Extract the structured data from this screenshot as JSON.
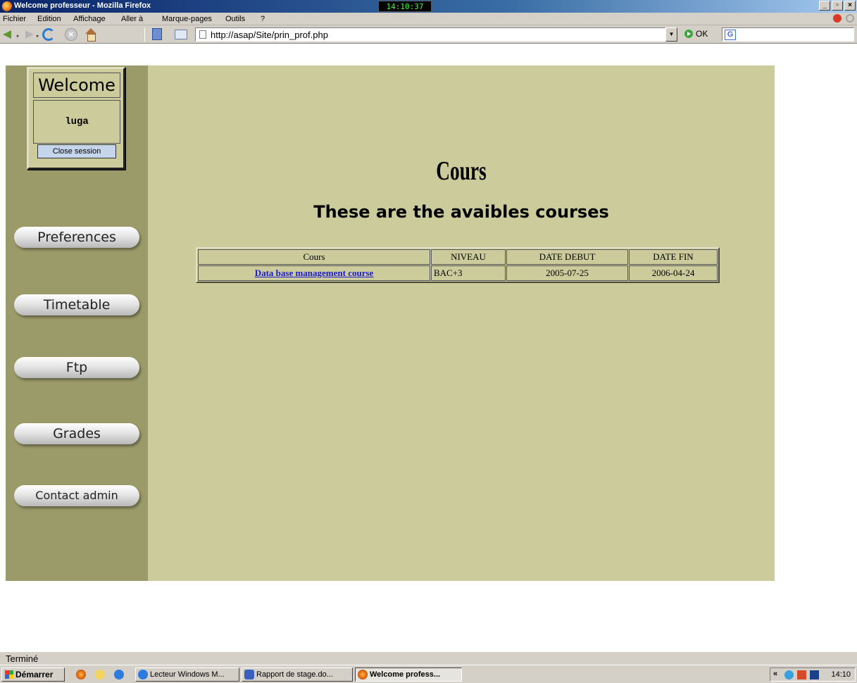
{
  "window": {
    "title": "Welcome professeur - Mozilla Firefox",
    "clock": "14:10:37",
    "minimize": "_",
    "maximize": "▫",
    "close": "×"
  },
  "menu": {
    "items": [
      "Fichier",
      "Edition",
      "Affichage",
      "Aller à",
      "Marque-pages",
      "Outils",
      "?"
    ]
  },
  "nav": {
    "url": "http://asap/Site/prin_prof.php",
    "go_label": "OK",
    "search_icon_letter": "G"
  },
  "sidebar": {
    "welcome_title": "Welcome",
    "username": "luga",
    "close_session": "Close session",
    "buttons": [
      "Preferences",
      "Timetable",
      "Ftp",
      "Grades",
      "Contact admin"
    ]
  },
  "main": {
    "heading": "Cours",
    "subheading": "These are the avaibles courses",
    "table": {
      "headers": [
        "Cours",
        "NIVEAU",
        "DATE DEBUT",
        "DATE FIN"
      ],
      "rows": [
        {
          "course": "Data base management course",
          "level": "BAC+3",
          "start": "2005-07-25",
          "end": "2006-04-24"
        }
      ]
    }
  },
  "status": {
    "text": "Terminé"
  },
  "taskbar": {
    "start": "Démarrer",
    "tasks": [
      "Lecteur Windows M...",
      "Rapport de stage.do...",
      "Welcome profess..."
    ],
    "time": "14:10"
  },
  "colors": {
    "sidebar_bg": "#9b9a69",
    "main_bg": "#cbcb9b",
    "link": "#1a1ad6"
  }
}
